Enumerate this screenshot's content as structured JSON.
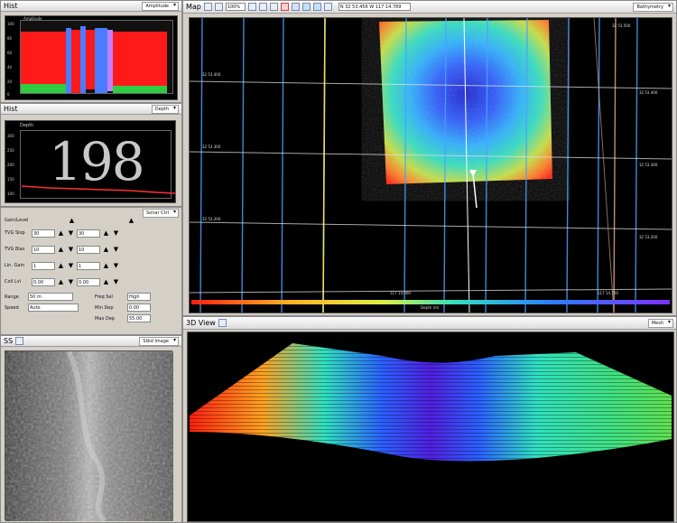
{
  "histogram": {
    "title": "Hist",
    "dropdown": "Amplitude",
    "y_labels": [
      "100",
      "80",
      "60",
      "40",
      "20",
      "0"
    ],
    "header_label": "Amplitude"
  },
  "depth_panel": {
    "title": "Hist",
    "dropdown": "Depth",
    "inner_label": "Depth",
    "value": "198",
    "y_labels": [
      "300",
      "250",
      "200",
      "150",
      "100"
    ]
  },
  "controls": {
    "dropdown": "Sonar Ctrl",
    "group_label": "Gain/Level",
    "rows": [
      {
        "label": "TVG Slop",
        "a": "30",
        "b": "30"
      },
      {
        "label": "TVG Bias",
        "a": "10",
        "b": "10"
      },
      {
        "label": "Lin. Gain",
        "a": "1",
        "b": "1"
      },
      {
        "label": "Coil Lvl",
        "a": "0.00",
        "b": "0.00"
      }
    ],
    "range_label": "Range",
    "range_value": "50 m",
    "speed_label": "Speed",
    "speed_value": "Auto",
    "freq_label": "Freq Sel",
    "freq_value": "High",
    "min_label": "Min Dep",
    "min_value": "0.00",
    "max_label": "Max Dep",
    "max_value": "55.00"
  },
  "sidescan": {
    "title": "SS",
    "dropdown": "Stbd Image"
  },
  "map": {
    "title": "Map",
    "toolbar_zoom": "100%",
    "coords_readout": "N 32 53.456 W 117 14.789",
    "dropdown": "Bathymetry",
    "grid_lat_labels": [
      "32 53.500",
      "32 53.400",
      "32 53.300",
      "32 53.200",
      "32 53.100"
    ],
    "grid_lon_labels": [
      "117 14.900",
      "117 14.700"
    ],
    "colorbar_label": "Depth (m)"
  },
  "view3d": {
    "title": "3D View",
    "dropdown": "Mesh"
  },
  "colors": {
    "bg": "#d4d0c8",
    "plot_bg": "#000000",
    "grid_blue": "#4aa0ff",
    "grid_white": "#e0e0e0",
    "bar_red": "#ff1a1a",
    "bar_green": "#2ecc40",
    "bar_blue": "#4a7cff"
  },
  "icons": [
    "hand-icon",
    "zoom-in-icon",
    "zoom-out-icon",
    "print-icon",
    "measure-icon",
    "flag-icon",
    "boat-icon"
  ]
}
